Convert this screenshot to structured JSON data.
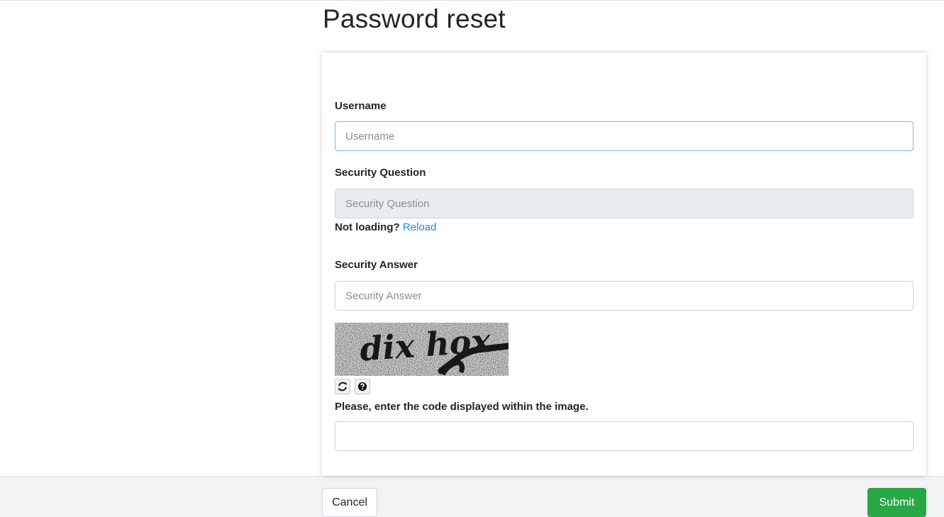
{
  "page": {
    "title": "Password reset"
  },
  "form": {
    "username": {
      "label": "Username",
      "placeholder": "Username",
      "value": ""
    },
    "security_question": {
      "label": "Security Question",
      "placeholder": "Security Question",
      "value": ""
    },
    "reload": {
      "prefix": "Not loading?",
      "link": "Reload"
    },
    "security_answer": {
      "label": "Security Answer",
      "placeholder": "Security Answer",
      "value": ""
    },
    "captcha": {
      "image_text": "dix hox",
      "refresh_icon": "refresh-icon",
      "help_icon": "question-icon",
      "instructions": "Please, enter the code displayed within the image.",
      "value": ""
    }
  },
  "actions": {
    "cancel_label": "Cancel",
    "submit_label": "Submit"
  },
  "colors": {
    "submit": "#28a745",
    "link": "#1e88e5",
    "focus_border": "#80b3f5",
    "disabled_bg": "#e9ecef",
    "footer_bg": "#f2f3f5"
  }
}
